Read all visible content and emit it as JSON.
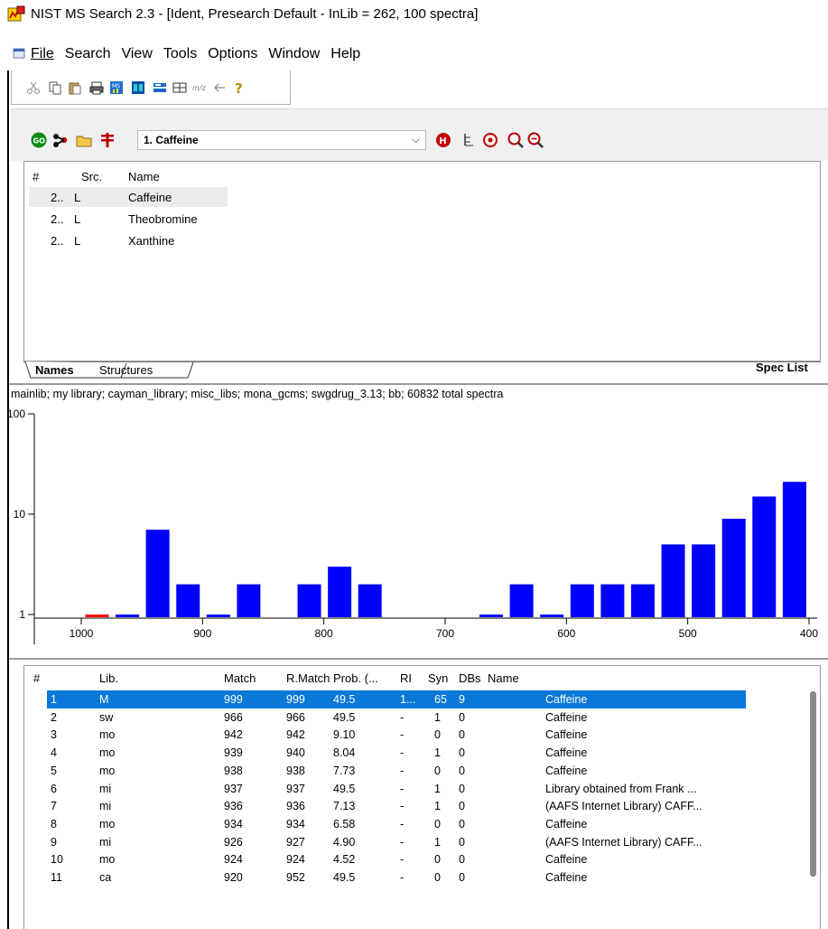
{
  "window": {
    "title": "NIST MS Search 2.3 - [Ident, Presearch Default - InLib = 262, 100 spectra]"
  },
  "menu": [
    "File",
    "Search",
    "View",
    "Tools",
    "Options",
    "Window",
    "Help"
  ],
  "search": {
    "combo_value": "1. Caffeine"
  },
  "hit_list": {
    "headers": [
      "#",
      "Src.",
      "Name"
    ],
    "rows": [
      {
        "num": "2..",
        "src": "L",
        "name": "Caffeine"
      },
      {
        "num": "2..",
        "src": "L",
        "name": "Theobromine"
      },
      {
        "num": "2..",
        "src": "L",
        "name": "Xanthine"
      }
    ]
  },
  "tabs": {
    "names": "Names",
    "structures": "Structures",
    "spec_list": "Spec List"
  },
  "histogram": {
    "libraries_line": "mainlib; my library; cayman_library; misc_libs; mona_gcms; swgdrug_3.13; bb;  60832 total spectra",
    "y_ticks": [
      "100",
      "10",
      "1"
    ],
    "x_ticks": [
      "1000",
      "900",
      "800",
      "700",
      "600",
      "500",
      "400"
    ]
  },
  "chart_data": {
    "type": "bar",
    "xlabel": "",
    "ylabel": "",
    "ylim": [
      1,
      100
    ],
    "y_scale": "log",
    "xlim": [
      1000,
      400
    ],
    "x": [
      987,
      962,
      937,
      912,
      887,
      862,
      812,
      787,
      762,
      662,
      637,
      612,
      587,
      562,
      537,
      512,
      487,
      462,
      437,
      412
    ],
    "values": [
      1,
      1,
      7,
      2,
      1,
      2,
      2,
      3,
      2,
      1,
      2,
      1,
      2,
      2,
      2,
      5,
      5,
      9,
      15,
      14
    ],
    "colors": [
      "#ff0000",
      "#0000ff",
      "#0000ff",
      "#0000ff",
      "#0000ff",
      "#0000ff",
      "#0000ff",
      "#0000ff",
      "#0000ff",
      "#0000ff",
      "#0000ff",
      "#0000ff",
      "#0000ff",
      "#0000ff",
      "#0000ff",
      "#0000ff",
      "#0000ff",
      "#0000ff",
      "#0000ff",
      "#0000ff"
    ],
    "last_bar": {
      "x": 412,
      "value": 21
    }
  },
  "results": {
    "headers": [
      "#",
      "Lib.",
      "Match",
      "R.Match",
      "Prob. (...",
      "RI",
      "Syn",
      "DBs",
      "Name"
    ],
    "selected_row": 0,
    "rows": [
      [
        "1",
        "M",
        "999",
        "999",
        "49.5",
        "1...",
        "65",
        "9",
        "Caffeine"
      ],
      [
        "2",
        "sw",
        "966",
        "966",
        "49.5",
        "-",
        "1",
        "0",
        "Caffeine"
      ],
      [
        "3",
        "mo",
        "942",
        "942",
        "9.10",
        "-",
        "0",
        "0",
        "Caffeine"
      ],
      [
        "4",
        "mo",
        "939",
        "940",
        "8.04",
        "-",
        "1",
        "0",
        "Caffeine"
      ],
      [
        "5",
        "mo",
        "938",
        "938",
        "7.73",
        "-",
        "0",
        "0",
        "Caffeine"
      ],
      [
        "6",
        "mi",
        "937",
        "937",
        "49.5",
        "-",
        "1",
        "0",
        "Library obtained from Frank ..."
      ],
      [
        "7",
        "mi",
        "936",
        "936",
        "7.13",
        "-",
        "1",
        "0",
        "(AAFS Internet Library) CAFF..."
      ],
      [
        "8",
        "mo",
        "934",
        "934",
        "6.58",
        "-",
        "0",
        "0",
        "Caffeine"
      ],
      [
        "9",
        "mi",
        "926",
        "927",
        "4.90",
        "-",
        "1",
        "0",
        "(AAFS Internet Library) CAFF..."
      ],
      [
        "10",
        "mo",
        "924",
        "924",
        "4.52",
        "-",
        "0",
        "0",
        "Caffeine"
      ],
      [
        "11",
        "ca",
        "920",
        "952",
        "49.5",
        "-",
        "0",
        "0",
        "Caffeine"
      ]
    ]
  }
}
